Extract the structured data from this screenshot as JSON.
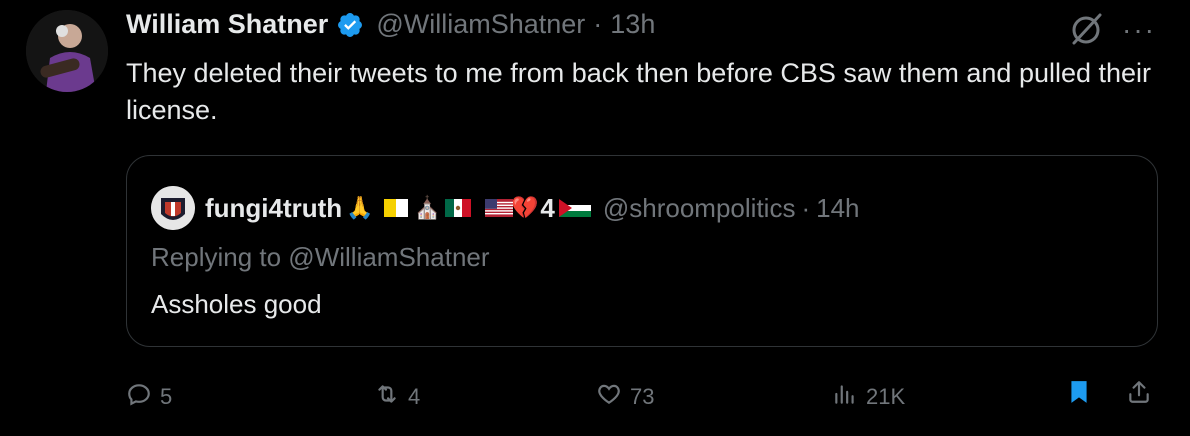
{
  "tweet": {
    "author_name": "William Shatner",
    "author_handle": "@WilliamShatner",
    "separator": "·",
    "time": "13h",
    "more_label": "···",
    "text": "They deleted their tweets to me from back then before CBS saw them and pulled their license."
  },
  "quoted": {
    "author_name": "fungi4truth",
    "emoji_1": "🙏",
    "emoji_2": "⛪",
    "emoji_3": "💔",
    "number": "4",
    "author_handle": "@shroompolitics",
    "separator": "·",
    "time": "14h",
    "replying_to": "Replying to @WilliamShatner",
    "text": "Assholes good"
  },
  "actions": {
    "replies": "5",
    "reposts": "4",
    "likes": "73",
    "views": "21K"
  },
  "colors": {
    "background": "#000000",
    "text": "#e7e9ea",
    "muted": "#71767b",
    "accent": "#1d9bf0"
  },
  "icons": [
    "verified-badge-icon",
    "grok-icon",
    "more-icon",
    "reply-icon",
    "repost-icon",
    "like-icon",
    "views-icon",
    "bookmark-icon",
    "share-icon"
  ]
}
